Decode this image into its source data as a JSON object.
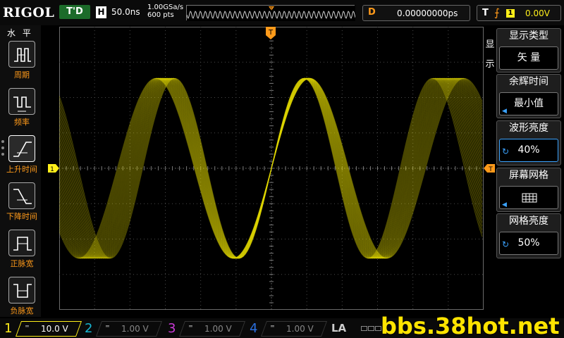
{
  "top": {
    "brand": "RIGOL",
    "run_state": "T'D",
    "horizontal_label": "H",
    "timebase": "50.0ns",
    "sample_rate": "1.00GSa/s",
    "memory_depth": "600 pts",
    "delay_label": "D",
    "delay_value": "0.00000000ps",
    "trigger_label": "T",
    "trigger_edge": "⨍",
    "trigger_source": "1",
    "trigger_level": "0.00V"
  },
  "left_menu": {
    "title": "水 平",
    "items": [
      {
        "label": "周期",
        "icon": "period-icon"
      },
      {
        "label": "频率",
        "icon": "frequency-icon"
      },
      {
        "label": "上升时间",
        "icon": "rise-time-icon"
      },
      {
        "label": "下降时间",
        "icon": "fall-time-icon"
      },
      {
        "label": "正脉宽",
        "icon": "positive-width-icon"
      },
      {
        "label": "负脉宽",
        "icon": "negative-width-icon"
      }
    ]
  },
  "display_menu": {
    "side_label_1": "显",
    "side_label_2": "示",
    "type_title": "显示类型",
    "type_value": "矢 量",
    "persist_title": "余辉时间",
    "persist_value": "最小值",
    "wave_intensity_title": "波形亮度",
    "wave_intensity_value": "40%",
    "grid_title": "屏幕网格",
    "grid_value_icon": "full-grid-icon",
    "grid_intensity_title": "网格亮度",
    "grid_intensity_value": "50%"
  },
  "markers": {
    "trigger_position": "T",
    "channel1_ground": "1",
    "trigger_level_marker": "T"
  },
  "waveform": {
    "channel": "1",
    "color": "#e0d800",
    "display_mode": "vector",
    "shape": "sine",
    "period_divisions": 4,
    "phase_spread_divisions": 1.6
  },
  "channels": [
    {
      "num": "1",
      "coupling": "═",
      "scale": "10.0 V",
      "color": "#ffef1a",
      "active": true
    },
    {
      "num": "2",
      "coupling": "═",
      "scale": "1.00 V",
      "color": "#17b6d2",
      "active": false
    },
    {
      "num": "3",
      "coupling": "═",
      "scale": "1.00 V",
      "color": "#cc3ad8",
      "active": false
    },
    {
      "num": "4",
      "coupling": "═",
      "scale": "1.00 V",
      "color": "#2b70e0",
      "active": false
    }
  ],
  "la_label": "LA",
  "watermark": "bbs.38hot.net",
  "colors": {
    "accent_orange": "#ff9a1a",
    "trace_yellow": "#e0d800",
    "select_blue": "#3ba3ff"
  }
}
